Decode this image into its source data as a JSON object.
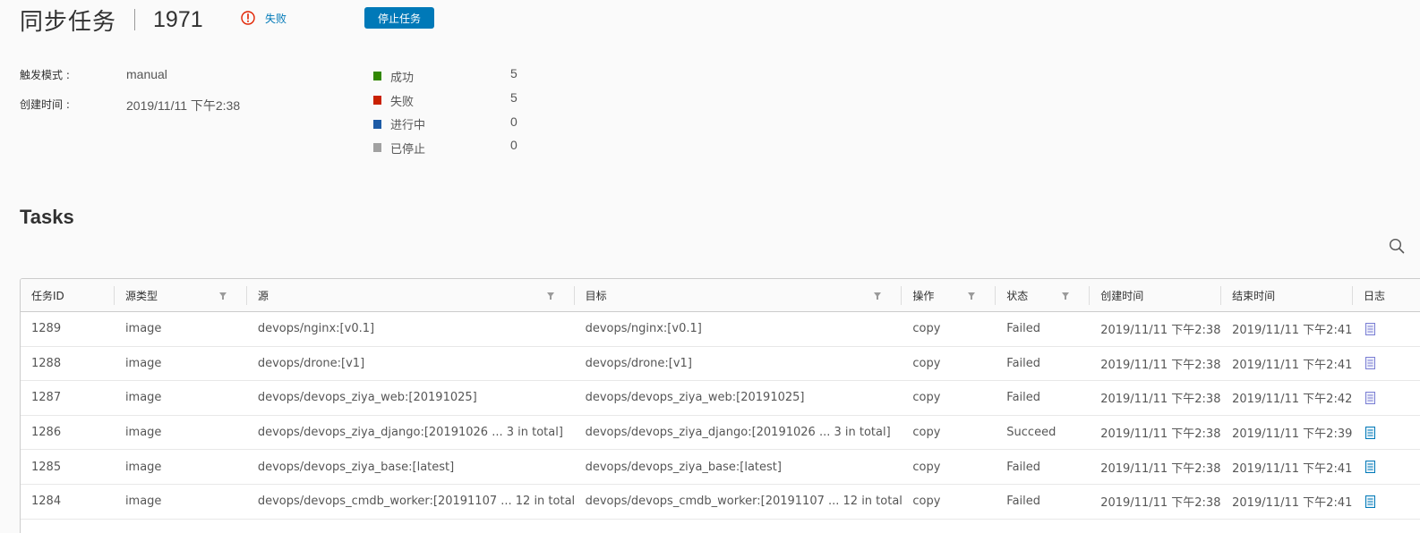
{
  "header": {
    "title": "同步任务",
    "job_id": "1971",
    "status": "失败",
    "stop_button": "停止任务"
  },
  "meta": {
    "trigger_label": "触发模式 :",
    "trigger_value": "manual",
    "created_label": "创建时间 :",
    "created_value": "2019/11/11 下午2:38"
  },
  "summary": [
    {
      "label": "成功",
      "count": "5",
      "color": "#318700"
    },
    {
      "label": "失败",
      "count": "5",
      "color": "#c92100"
    },
    {
      "label": "进行中",
      "count": "0",
      "color": "#1d5ba6"
    },
    {
      "label": "已停止",
      "count": "0",
      "color": "#a1a1a1"
    }
  ],
  "tasks": {
    "title": "Tasks",
    "columns": [
      "任务ID",
      "源类型",
      "源",
      "目标",
      "操作",
      "状态",
      "创建时间",
      "结束时间",
      "日志"
    ],
    "rows": [
      [
        "1289",
        "image",
        "devops/nginx:[v0.1]",
        "devops/nginx:[v0.1]",
        "copy",
        "Failed",
        "2019/11/11 下午2:38",
        "2019/11/11 下午2:41"
      ],
      [
        "1288",
        "image",
        "devops/drone:[v1]",
        "devops/drone:[v1]",
        "copy",
        "Failed",
        "2019/11/11 下午2:38",
        "2019/11/11 下午2:41"
      ],
      [
        "1287",
        "image",
        "devops/devops_ziya_web:[20191025]",
        "devops/devops_ziya_web:[20191025]",
        "copy",
        "Failed",
        "2019/11/11 下午2:38",
        "2019/11/11 下午2:42"
      ],
      [
        "1286",
        "image",
        "devops/devops_ziya_django:[20191026 ... 3 in total]",
        "devops/devops_ziya_django:[20191026 ... 3 in total]",
        "copy",
        "Succeed",
        "2019/11/11 下午2:38",
        "2019/11/11 下午2:39"
      ],
      [
        "1285",
        "image",
        "devops/devops_ziya_base:[latest]",
        "devops/devops_ziya_base:[latest]",
        "copy",
        "Failed",
        "2019/11/11 下午2:38",
        "2019/11/11 下午2:41"
      ],
      [
        "1284",
        "image",
        "devops/devops_cmdb_worker:[20191107 ... 12 in total]",
        "devops/devops_cmdb_worker:[20191107 ... 12 in total]",
        "copy",
        "Failed",
        "2019/11/11 下午2:38",
        "2019/11/11 下午2:41"
      ]
    ]
  },
  "colors": {
    "primary": "#0079b8",
    "error": "#e12200",
    "log_icon_failed": "#7b7fd4",
    "log_icon_succeed": "#0079b8"
  }
}
